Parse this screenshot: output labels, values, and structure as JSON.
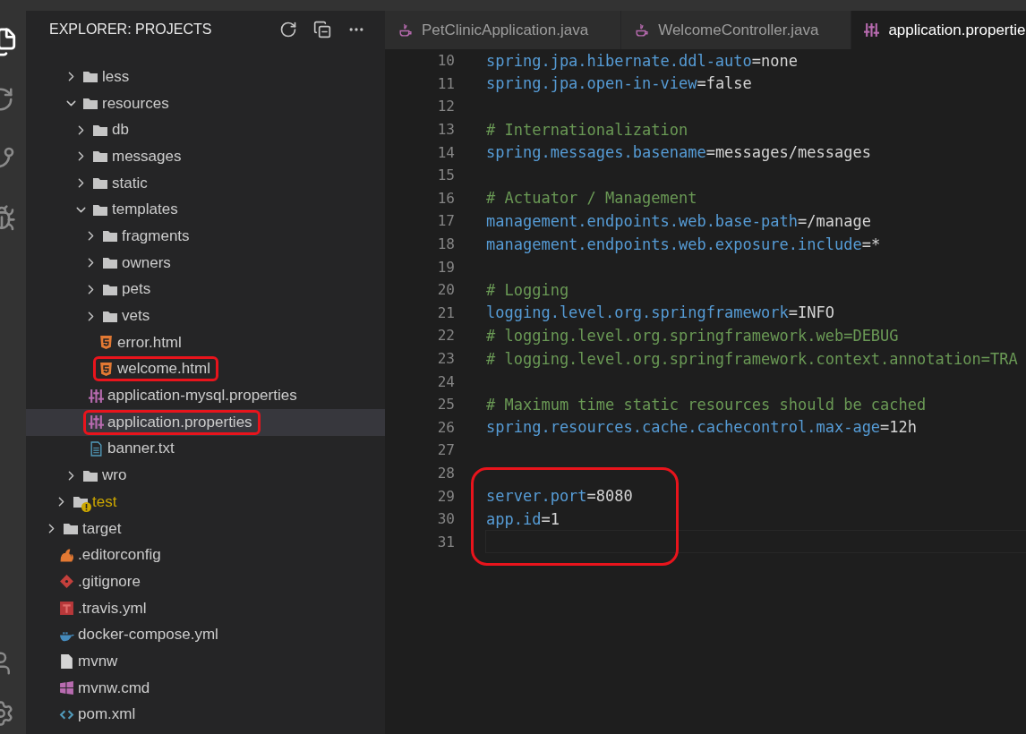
{
  "sidebar": {
    "title": "EXPLORER: PROJECTS",
    "tree": [
      {
        "kind": "continued",
        "children": [
          {
            "kind": "continued",
            "children": [
              {
                "kind": "folder",
                "label": "less",
                "expanded": false,
                "warning": false
              },
              {
                "kind": "folder",
                "label": "resources",
                "expanded": true,
                "warning": false,
                "children": [
                  {
                    "kind": "folder",
                    "label": "db",
                    "expanded": false,
                    "warning": false
                  },
                  {
                    "kind": "folder",
                    "label": "messages",
                    "expanded": false,
                    "warning": false
                  },
                  {
                    "kind": "folder",
                    "label": "static",
                    "expanded": false,
                    "warning": false
                  },
                  {
                    "kind": "folder",
                    "label": "templates",
                    "expanded": true,
                    "warning": false,
                    "children": [
                      {
                        "kind": "folder",
                        "label": "fragments",
                        "expanded": false,
                        "warning": false
                      },
                      {
                        "kind": "folder",
                        "label": "owners",
                        "expanded": false,
                        "warning": false
                      },
                      {
                        "kind": "folder",
                        "label": "pets",
                        "expanded": false,
                        "warning": false
                      },
                      {
                        "kind": "folder",
                        "label": "vets",
                        "expanded": false,
                        "warning": false
                      },
                      {
                        "kind": "html",
                        "label": "error.html",
                        "highlighted": false,
                        "selected": false
                      },
                      {
                        "kind": "html",
                        "label": "welcome.html",
                        "highlighted": true,
                        "selected": false
                      }
                    ]
                  },
                  {
                    "kind": "properties",
                    "label": "application-mysql.properties",
                    "highlighted": false,
                    "selected": false
                  },
                  {
                    "kind": "properties",
                    "label": "application.properties",
                    "highlighted": true,
                    "selected": true
                  },
                  {
                    "kind": "text",
                    "label": "banner.txt",
                    "highlighted": false,
                    "selected": false
                  }
                ]
              },
              {
                "kind": "folder",
                "label": "wro",
                "expanded": false,
                "warning": false
              }
            ]
          },
          {
            "kind": "folder",
            "label": "test",
            "expanded": false,
            "warning": true
          }
        ]
      },
      {
        "kind": "folder",
        "label": "target",
        "expanded": false,
        "warning": false
      },
      {
        "kind": "editorconfig",
        "label": ".editorconfig",
        "highlighted": false,
        "selected": false
      },
      {
        "kind": "git",
        "label": ".gitignore",
        "highlighted": false,
        "selected": false
      },
      {
        "kind": "travis",
        "label": ".travis.yml",
        "highlighted": false,
        "selected": false
      },
      {
        "kind": "docker",
        "label": "docker-compose.yml",
        "highlighted": false,
        "selected": false
      },
      {
        "kind": "file",
        "label": "mvnw",
        "highlighted": false,
        "selected": false
      },
      {
        "kind": "windows",
        "label": "mvnw.cmd",
        "highlighted": false,
        "selected": false
      },
      {
        "kind": "xml",
        "label": "pom.xml",
        "highlighted": false,
        "selected": false
      }
    ]
  },
  "tabs": [
    {
      "label": "PetClinicApplication.java",
      "kind": "java",
      "selected": false
    },
    {
      "label": "WelcomeController.java",
      "kind": "java",
      "selected": false
    },
    {
      "label": "application.propertie",
      "kind": "properties",
      "selected": true
    }
  ],
  "editor": {
    "lines": [
      {
        "number": "10",
        "key": "spring.jpa.hibernate.ddl-auto",
        "value": "=none"
      },
      {
        "number": "11",
        "key": "spring.jpa.open-in-view",
        "value": "=false"
      },
      {
        "number": "12"
      },
      {
        "number": "13",
        "comment": "# Internationalization"
      },
      {
        "number": "14",
        "key": "spring.messages.basename",
        "value": "=messages/messages"
      },
      {
        "number": "15"
      },
      {
        "number": "16",
        "comment": "# Actuator / Management"
      },
      {
        "number": "17",
        "key": "management.endpoints.web.base-path",
        "value": "=/manage"
      },
      {
        "number": "18",
        "key": "management.endpoints.web.exposure.include",
        "value": "=*"
      },
      {
        "number": "19"
      },
      {
        "number": "20",
        "comment": "# Logging"
      },
      {
        "number": "21",
        "key": "logging.level.org.springframework",
        "value": "=INFO"
      },
      {
        "number": "22",
        "comment": "# logging.level.org.springframework.web=DEBUG"
      },
      {
        "number": "23",
        "comment": "# logging.level.org.springframework.context.annotation=TRA"
      },
      {
        "number": "24"
      },
      {
        "number": "25",
        "comment": "# Maximum time static resources should be cached"
      },
      {
        "number": "26",
        "key": "spring.resources.cache.cachecontrol.max-age",
        "value": "=12h"
      },
      {
        "number": "27"
      },
      {
        "number": "28",
        "outlined": true
      },
      {
        "number": "29",
        "key": "server.port",
        "value": "=8080",
        "outlined": true
      },
      {
        "number": "30",
        "key": "app.id",
        "value": "=1",
        "outlined": true
      },
      {
        "number": "31",
        "current": true,
        "outlined": true
      }
    ]
  }
}
